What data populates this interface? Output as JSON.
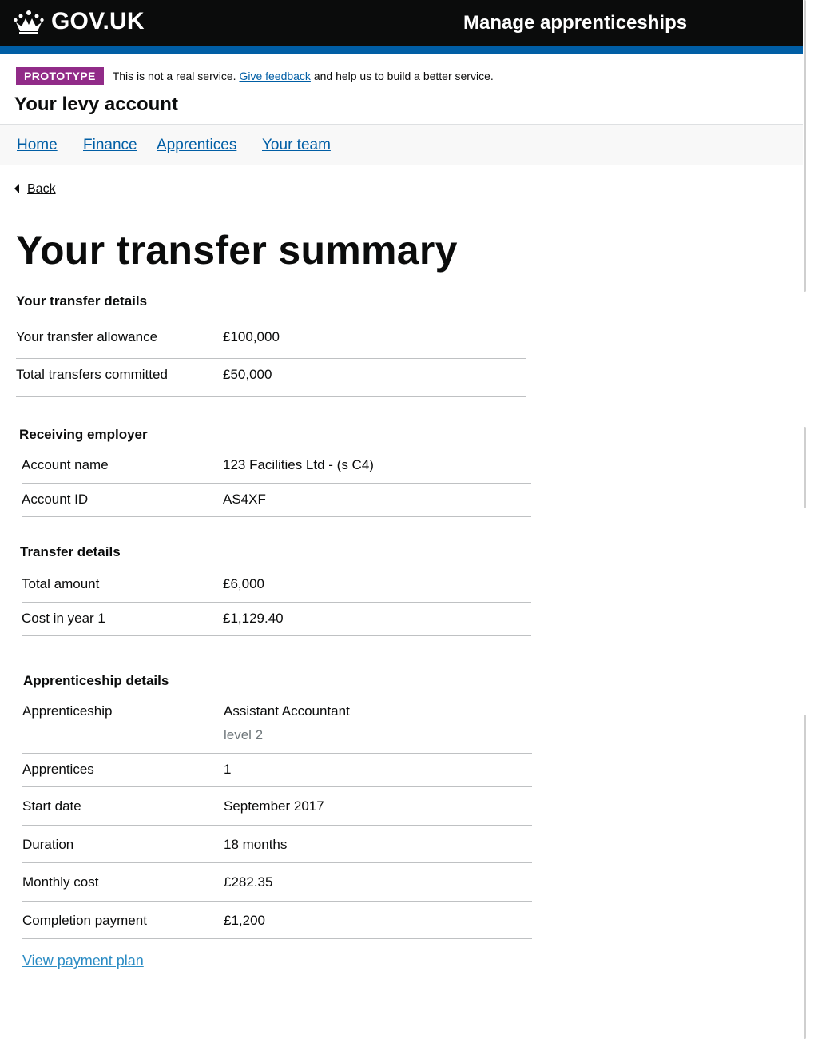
{
  "header": {
    "logo_text": "GOV.UK",
    "service_name": "Manage apprenticeships"
  },
  "phase_banner": {
    "tag": "PROTOTYPE",
    "text_before": "This is not a real service.",
    "link": "Give feedback",
    "text_after": "and help us to build a better service."
  },
  "account_title": "Your levy account",
  "nav": {
    "items": [
      "Home",
      "Finance",
      "Apprentices",
      "Your team"
    ]
  },
  "back_link": "Back",
  "page_title": "Your transfer summary",
  "transfer_details_section": {
    "heading": "Your transfer details",
    "rows": [
      {
        "key": "Your transfer allowance",
        "value": "£100,000"
      },
      {
        "key": "Total transfers committed",
        "value": "£50,000"
      }
    ]
  },
  "receiving_employer": {
    "heading": "Receiving employer",
    "rows": [
      {
        "key": "Account name",
        "value": "123 Facilities Ltd - (s C4)"
      },
      {
        "key": "Account ID",
        "value": "AS4XF"
      }
    ]
  },
  "transfer_details": {
    "heading": "Transfer details",
    "rows": [
      {
        "key": "Total amount",
        "value": "£6,000"
      },
      {
        "key": "Cost in year 1",
        "value": "£1,129.40"
      }
    ]
  },
  "apprenticeship_details": {
    "heading": "Apprenticeship details",
    "rows": [
      {
        "key": "Apprenticeship",
        "value": "Assistant Accountant",
        "sub": "level 2"
      },
      {
        "key": "Apprentices",
        "value": "1"
      },
      {
        "key": "Start date",
        "value": "September 2017"
      },
      {
        "key": "Duration",
        "value": "18 months"
      },
      {
        "key": "Monthly cost",
        "value": "£282.35"
      },
      {
        "key": "Completion payment",
        "value": "£1,200"
      }
    ]
  },
  "view_payment_plan": "View payment plan",
  "colors": {
    "header_bg": "#0b0c0c",
    "header_stripe": "#005ea5",
    "phase_tag": "#912b88",
    "link": "#005ea5"
  }
}
